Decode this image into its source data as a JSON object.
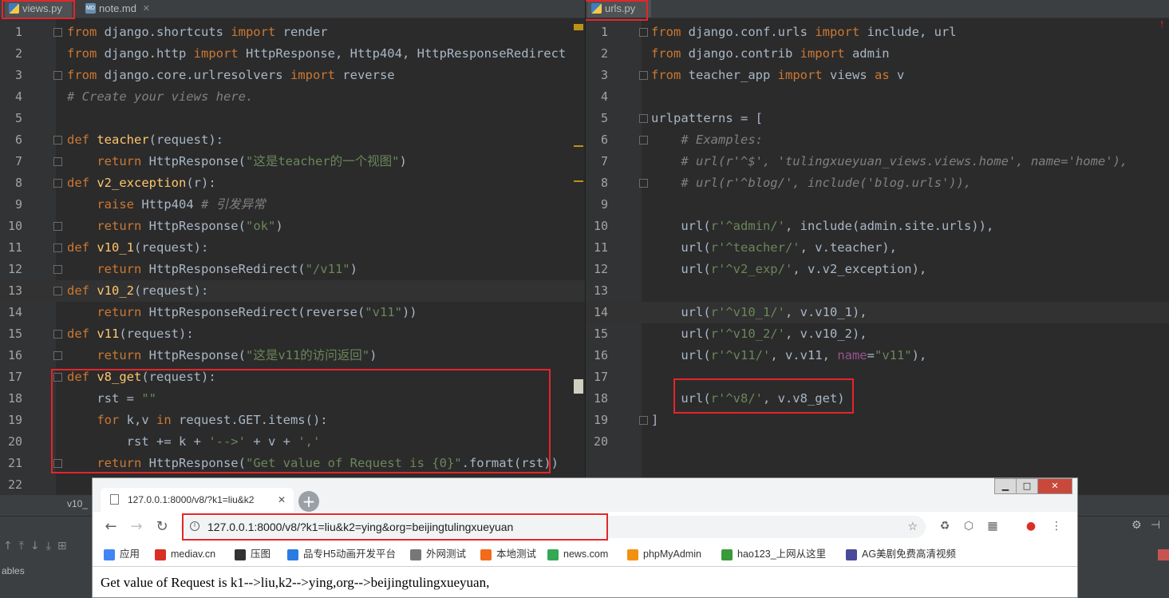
{
  "left_editor": {
    "tabs": [
      {
        "label": "views.py",
        "active": true
      },
      {
        "label": "note.md",
        "active": false
      }
    ],
    "lines": [
      {
        "n": "1",
        "html": "<span class=\"kw\">from</span> django.shortcuts <span class=\"kw\">import</span> render",
        "muted": true
      },
      {
        "n": "2",
        "html": "<span class=\"kw\">from</span> django.http <span class=\"kw\">import</span> HttpResponse, Http404, HttpResponseRedirect"
      },
      {
        "n": "3",
        "html": "<span class=\"kw\">from</span> django.core.urlresolvers <span class=\"kw\">import</span> reverse"
      },
      {
        "n": "4",
        "html": "<span class=\"cm\"># Create your views here.</span>"
      },
      {
        "n": "5",
        "html": ""
      },
      {
        "n": "6",
        "html": "<span class=\"kw\">def</span> <span class=\"fn\">teacher</span>(request):"
      },
      {
        "n": "7",
        "html": "    <span class=\"kw\">return</span> HttpResponse(<span class=\"st\">\"这是teacher的一个视图\"</span>)"
      },
      {
        "n": "8",
        "html": "<span class=\"kw\">def</span> <span class=\"fn\">v2_exception</span>(r):"
      },
      {
        "n": "9",
        "html": "    <span class=\"kw\">raise</span> Http404 <span class=\"cm\"># 引发异常</span>"
      },
      {
        "n": "10",
        "html": "    <span class=\"kw\">return</span> HttpResponse(<span class=\"st\">\"ok\"</span>)"
      },
      {
        "n": "11",
        "html": "<span class=\"kw\">def</span> <span class=\"fn\">v10_1</span>(request):"
      },
      {
        "n": "12",
        "html": "    <span class=\"kw\">return</span> HttpResponseRedirect(<span class=\"st\">\"/v11\"</span>)"
      },
      {
        "n": "13",
        "html": "<span class=\"kw\">def</span> <span class=\"fn\">v10_2</span>(request):"
      },
      {
        "n": "14",
        "html": "    <span class=\"kw\">return</span> HttpResponseRedirect(reverse(<span class=\"st\">\"v11\"</span>))"
      },
      {
        "n": "15",
        "html": "<span class=\"kw\">def</span> <span class=\"fn\">v11</span>(request):"
      },
      {
        "n": "16",
        "html": "    <span class=\"kw\">return</span> HttpResponse(<span class=\"st\">\"这是v11的访问返回\"</span>)"
      },
      {
        "n": "17",
        "html": "<span class=\"kw\">def</span> <span class=\"fn\">v8_get</span>(request):"
      },
      {
        "n": "18",
        "html": "    rst = <span class=\"st\">\"\"</span>"
      },
      {
        "n": "19",
        "html": "    <span class=\"kw\">for</span> k,v <span class=\"kw\">in</span> request.GET.items():"
      },
      {
        "n": "20",
        "html": "        rst += k + <span class=\"st\">'-->'</span> + v + <span class=\"st\">','</span>"
      },
      {
        "n": "21",
        "html": "    <span class=\"kw\">return</span> HttpResponse(<span class=\"st\">\"Get value of Request is {0}\"</span>.format(rst))"
      },
      {
        "n": "22",
        "html": ""
      }
    ]
  },
  "right_editor": {
    "tabs": [
      {
        "label": "urls.py",
        "active": true
      }
    ],
    "lines": [
      {
        "n": "1",
        "html": "<span class=\"kw\">from</span> django.conf.urls <span class=\"kw\">import</span> include, url"
      },
      {
        "n": "2",
        "html": "<span class=\"kw\">from</span> django.contrib <span class=\"kw\">import</span> admin"
      },
      {
        "n": "3",
        "html": "<span class=\"kw\">from</span> teacher_app <span class=\"kw\">import</span> views <span class=\"kw\">as</span> v"
      },
      {
        "n": "4",
        "html": ""
      },
      {
        "n": "5",
        "html": "urlpatterns = ["
      },
      {
        "n": "6",
        "html": "    <span class=\"cm\"># Examples:</span>"
      },
      {
        "n": "7",
        "html": "    <span class=\"cm\"># url(r'^$', 'tulingxueyuan_views.views.home', name='home'),</span>"
      },
      {
        "n": "8",
        "html": "    <span class=\"cm\"># url(r'^blog/', include('blog.urls')),</span>"
      },
      {
        "n": "9",
        "html": ""
      },
      {
        "n": "10",
        "html": "    url(<span class=\"st\">r'^admin/'</span>, include(admin.site.urls)),"
      },
      {
        "n": "11",
        "html": "    url(<span class=\"st\">r'^teacher/'</span>, v.teacher),"
      },
      {
        "n": "12",
        "html": "    url(<span class=\"st\">r'^v2_exp/'</span>, v.v2_exception),"
      },
      {
        "n": "13",
        "html": ""
      },
      {
        "n": "14",
        "html": "    url(<span class=\"st\">r'^v10_1/'</span>, v.v10_1),"
      },
      {
        "n": "15",
        "html": "    url(<span class=\"st\">r'^v10_2/'</span>, v.v10_2),"
      },
      {
        "n": "16",
        "html": "    url(<span class=\"st\">r'^v11/'</span>, v.v11, <span class=\"pr\">name</span>=<span class=\"st\">\"v11\"</span>),"
      },
      {
        "n": "17",
        "html": ""
      },
      {
        "n": "18",
        "html": "    url(<span class=\"st\">r'^v8/'</span>, v.v8_get)"
      },
      {
        "n": "19",
        "html": "]"
      },
      {
        "n": "20",
        "html": ""
      }
    ]
  },
  "ide_bottom": {
    "tab_fragment": "v10_",
    "panel_label": "ables"
  },
  "browser": {
    "tab_title": "127.0.0.1:8000/v8/?k1=liu&k2",
    "address": "127.0.0.1:8000/v8/?k1=liu&k2=ying&org=beijingtulingxueyuan",
    "bookmarks": [
      {
        "label": "应用",
        "color": "#4285f4"
      },
      {
        "label": "mediav.cn",
        "color": "#d93025"
      },
      {
        "label": "压图",
        "color": "#333333"
      },
      {
        "label": "品专H5动画开发平台",
        "color": "#2a7be4"
      },
      {
        "label": "外网测试",
        "color": "#777777"
      },
      {
        "label": "本地测试",
        "color": "#f26a1b"
      },
      {
        "label": "news.com",
        "color": "#34a853"
      },
      {
        "label": "phpMyAdmin",
        "color": "#f29111"
      },
      {
        "label": "hao123_上网从这里",
        "color": "#3a9a3a"
      },
      {
        "label": "AG美剧免费高清视频",
        "color": "#4a4a9a"
      }
    ],
    "page_text": "Get value of Request is k1-->liu,k2-->ying,org-->beijingtulingxueyuan,"
  },
  "colors": {
    "annotation_red": "#e5252a",
    "editor_bg": "#2b2b2b",
    "keyword": "#cc7832",
    "string": "#6a8759"
  }
}
